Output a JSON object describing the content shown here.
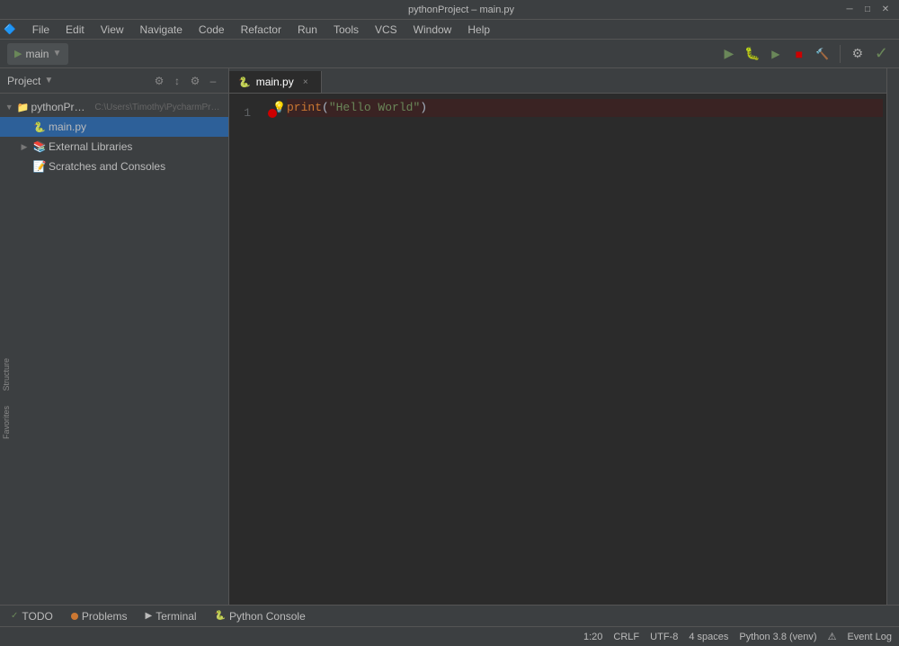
{
  "window": {
    "title": "pythonProject – main.py",
    "minimize_label": "─",
    "maximize_label": "□",
    "close_label": "✕"
  },
  "menu": {
    "items": [
      "File",
      "Edit",
      "View",
      "Navigate",
      "Code",
      "Refactor",
      "Run",
      "Tools",
      "VCS",
      "Window",
      "Help"
    ]
  },
  "toolbar": {
    "run_config": "main",
    "run_arrow": "▼"
  },
  "sidebar": {
    "title": "Project",
    "dropdown_arrow": "▼",
    "tools": [
      "⚙",
      "↕",
      "⚙",
      "–"
    ],
    "tree": [
      {
        "indent": 0,
        "arrow": "▼",
        "icon": "📁",
        "label": "pythonProject",
        "path": "C:\\Users\\Timothy\\PycharmProjects\\p",
        "type": "project-root",
        "selected": false
      },
      {
        "indent": 1,
        "arrow": "",
        "icon": "🐍",
        "label": "main.py",
        "path": "",
        "type": "py-file",
        "selected": true
      },
      {
        "indent": 1,
        "arrow": "▶",
        "icon": "📚",
        "label": "External Libraries",
        "path": "",
        "type": "library",
        "selected": false
      },
      {
        "indent": 1,
        "arrow": "",
        "icon": "📝",
        "label": "Scratches and Consoles",
        "path": "",
        "type": "scratch",
        "selected": false
      }
    ]
  },
  "editor": {
    "tab_label": "main.py",
    "code_lines": [
      {
        "number": "1",
        "content": "print(\"Hello World\")",
        "highlighted": true
      }
    ]
  },
  "vertical_tools": [
    "Structure",
    "Favorites"
  ],
  "status_bar": {
    "left": [],
    "right": [
      {
        "label": "1:20"
      },
      {
        "label": "CRLF"
      },
      {
        "label": "UTF-8"
      },
      {
        "label": "4 spaces"
      },
      {
        "label": "Python 3.8 (venv)"
      },
      {
        "label": "⚠"
      },
      {
        "label": "Event Log"
      }
    ]
  },
  "bottom_tabs": [
    {
      "label": "TODO",
      "icon": "✓",
      "dot_color": "",
      "active": false
    },
    {
      "label": "Problems",
      "icon": "⚠",
      "dot_color": "#cc7832",
      "active": false
    },
    {
      "label": "Terminal",
      "icon": "▶",
      "dot_color": "",
      "active": false
    },
    {
      "label": "Python Console",
      "icon": "🐍",
      "dot_color": "",
      "active": false
    }
  ]
}
